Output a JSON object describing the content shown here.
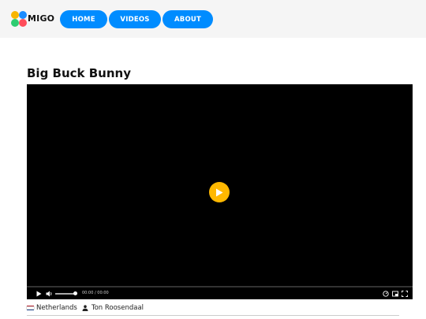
{
  "colors": {
    "nav_bg": "#008cff",
    "play_button": "#ffb800",
    "logo_dots": [
      "#f7b500",
      "#1a8cff",
      "#2ecc71",
      "#ff4d5a"
    ]
  },
  "header": {
    "logo_text": "MIGO",
    "nav": [
      {
        "label": "HOME"
      },
      {
        "label": "VIDEOS"
      },
      {
        "label": "ABOUT"
      }
    ]
  },
  "video": {
    "title": "Big Buck Bunny",
    "time_display": "00:00 / 00:00",
    "progress": 0,
    "volume": 1,
    "icons": {
      "big_play": "play-icon",
      "play": "play-icon",
      "volume": "volume-icon",
      "speed": "speed-icon",
      "pip": "picture-in-picture-icon",
      "fullscreen": "fullscreen-icon"
    }
  },
  "meta": {
    "country": "Netherlands",
    "country_flag": "netherlands-flag-icon",
    "author": "Ton Roosendaal",
    "author_icon": "person-icon"
  }
}
